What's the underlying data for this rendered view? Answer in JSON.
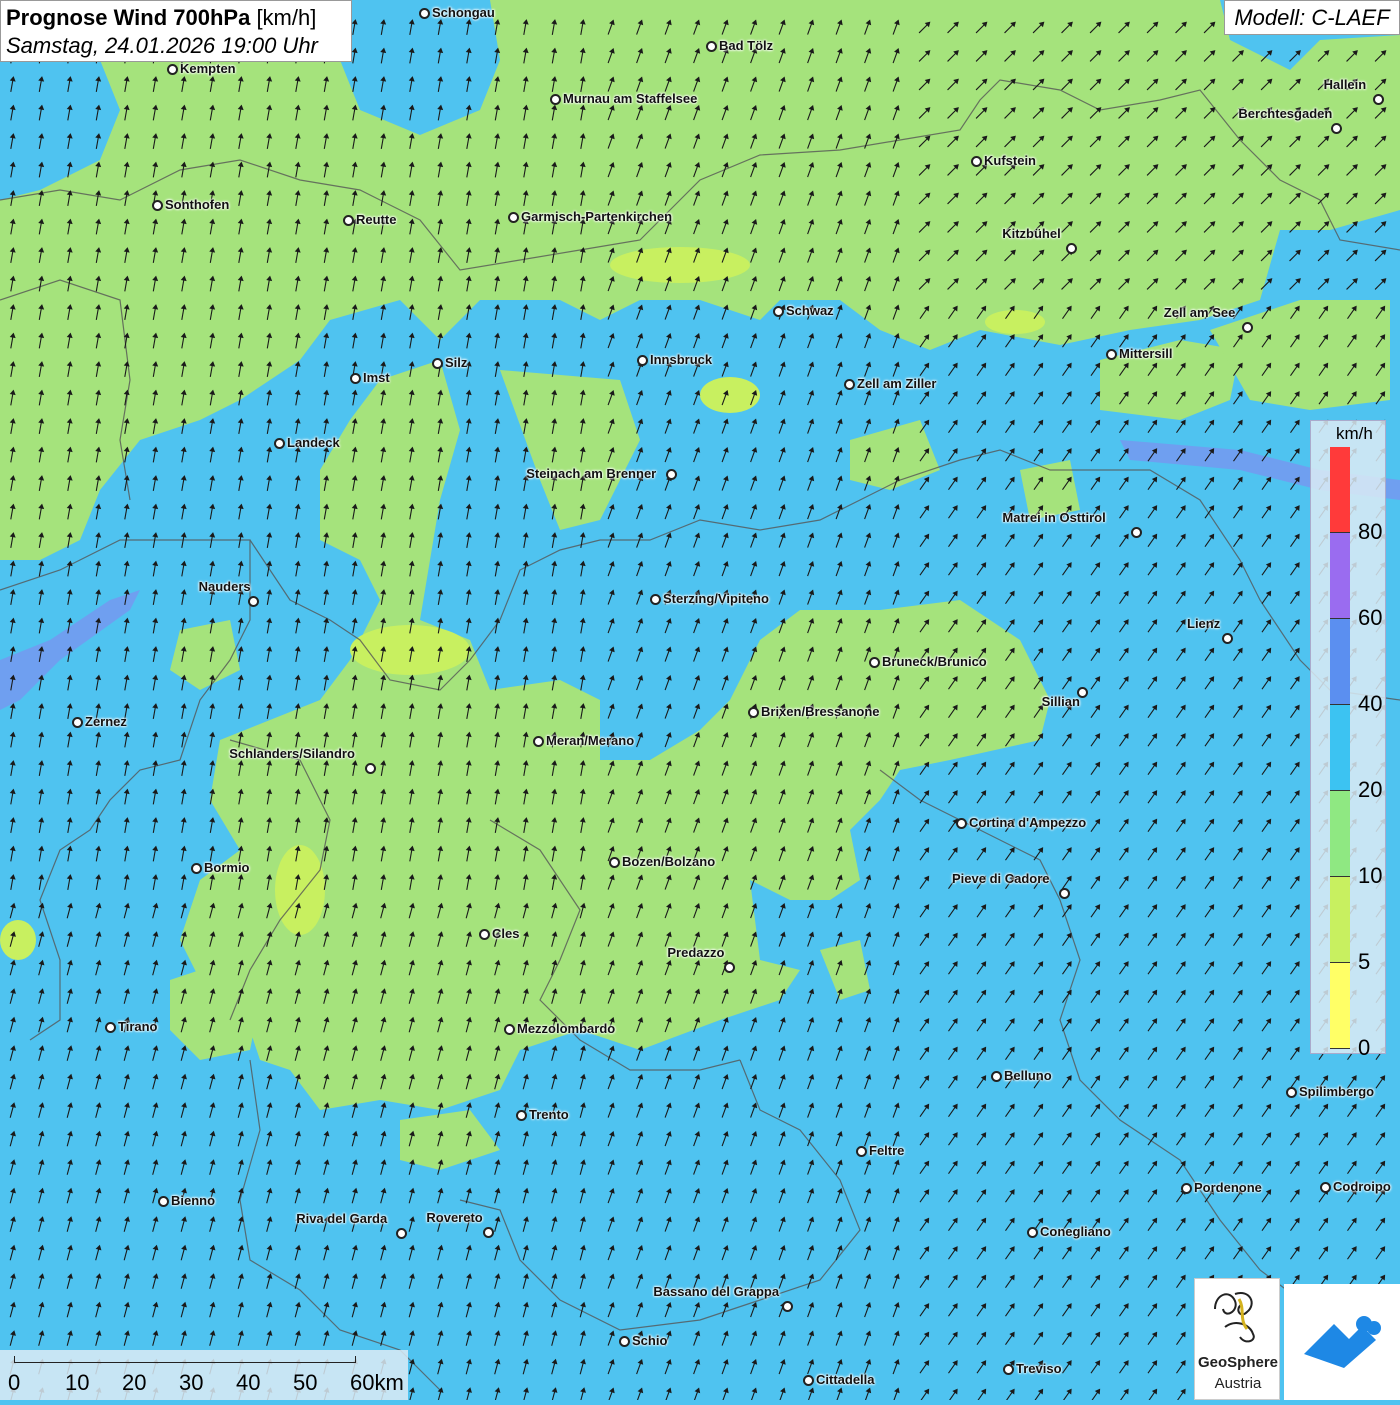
{
  "header": {
    "title_bold": "Prognose Wind 700hPa",
    "title_unit": "[km/h]",
    "datetime": "Samstag, 24.01.2026 19:00 Uhr",
    "model": "Modell: C-LAEF"
  },
  "legend": {
    "unit": "km/h",
    "bins": [
      {
        "label": "80",
        "color": "#ff3a3a"
      },
      {
        "label": "60",
        "color": "#9a6cf0"
      },
      {
        "label": "40",
        "color": "#5b8ff0"
      },
      {
        "label": "20",
        "color": "#3cc3f2"
      },
      {
        "label": "10",
        "color": "#8fe882"
      },
      {
        "label": "5",
        "color": "#c8f060"
      },
      {
        "label": "0",
        "color": "#ffff66"
      }
    ]
  },
  "scale": {
    "labels": [
      "0",
      "10",
      "20",
      "30",
      "40",
      "50",
      "60km"
    ]
  },
  "logos": {
    "geosphere_line1": "GeoSphere",
    "geosphere_line2": "Austria"
  },
  "colors": {
    "wind_lt10": "#a5e37c",
    "wind_10_20": "#4fc3f0",
    "wind_20_40": "#5b8ff0",
    "wind_lt5": "#c8f060",
    "arrow": "#1a1a1a",
    "border": "#555555"
  },
  "cities": [
    {
      "name": "Schongau",
      "label_side": "right"
    },
    {
      "name": "Bad Tölz",
      "label_side": "right"
    },
    {
      "name": "Kempten",
      "label_side": "right"
    },
    {
      "name": "Murnau am Staffelsee",
      "label_side": "right"
    },
    {
      "name": "Hallein",
      "label_side": "left-above"
    },
    {
      "name": "Berchtesgaden",
      "label_side": "left-above"
    },
    {
      "name": "Kufstein",
      "label_side": "right"
    },
    {
      "name": "Sonthofen",
      "label_side": "right"
    },
    {
      "name": "Reutte",
      "label_side": "right"
    },
    {
      "name": "Garmisch-Partenkirchen",
      "label_side": "right"
    },
    {
      "name": "Kitzbühel",
      "label_side": "left-above"
    },
    {
      "name": "Schwaz",
      "label_side": "right"
    },
    {
      "name": "Zell am See",
      "label_side": "left-above"
    },
    {
      "name": "Innsbruck",
      "label_side": "right"
    },
    {
      "name": "Mittersill",
      "label_side": "right"
    },
    {
      "name": "Silz",
      "label_side": "right"
    },
    {
      "name": "Imst",
      "label_side": "right"
    },
    {
      "name": "Zell am Ziller",
      "label_side": "right"
    },
    {
      "name": "Landeck",
      "label_side": "right"
    },
    {
      "name": "Steinach am Brenner",
      "label_side": "left"
    },
    {
      "name": "Matrei in Osttirol",
      "label_side": "left-above"
    },
    {
      "name": "Nauders",
      "label_side": "left-above"
    },
    {
      "name": "Sterzing/Vipiteno",
      "label_side": "right"
    },
    {
      "name": "Lienz",
      "label_side": "left-above"
    },
    {
      "name": "Bruneck/Brunico",
      "label_side": "right"
    },
    {
      "name": "Sillian",
      "label_side": "left-below"
    },
    {
      "name": "Brixen/Bressanone",
      "label_side": "right"
    },
    {
      "name": "Zernez",
      "label_side": "right"
    },
    {
      "name": "Meran/Merano",
      "label_side": "right"
    },
    {
      "name": "Schlanders/Silandro",
      "label_side": "left-above"
    },
    {
      "name": "Cortina d'Ampezzo",
      "label_side": "right"
    },
    {
      "name": "Bozen/Bolzano",
      "label_side": "right"
    },
    {
      "name": "Bormio",
      "label_side": "right"
    },
    {
      "name": "Pieve di Cadore",
      "label_side": "left-above"
    },
    {
      "name": "Cles",
      "label_side": "right"
    },
    {
      "name": "Predazzo",
      "label_side": "left-above"
    },
    {
      "name": "Tirano",
      "label_side": "right"
    },
    {
      "name": "Mezzolombardo",
      "label_side": "right"
    },
    {
      "name": "Belluno",
      "label_side": "right"
    },
    {
      "name": "Spilimbergo",
      "label_side": "right"
    },
    {
      "name": "Trento",
      "label_side": "right"
    },
    {
      "name": "Feltre",
      "label_side": "right"
    },
    {
      "name": "Pordenone",
      "label_side": "right"
    },
    {
      "name": "Codroipo",
      "label_side": "right"
    },
    {
      "name": "Bienno",
      "label_side": "right"
    },
    {
      "name": "Riva del Garda",
      "label_side": "left-above"
    },
    {
      "name": "Rovereto",
      "label_side": "left-above"
    },
    {
      "name": "Conegliano",
      "label_side": "right"
    },
    {
      "name": "Bassano del Grappa",
      "label_side": "left-above"
    },
    {
      "name": "Schio",
      "label_side": "right"
    },
    {
      "name": "Treviso",
      "label_side": "right"
    },
    {
      "name": "Cittadella",
      "label_side": "right"
    }
  ]
}
